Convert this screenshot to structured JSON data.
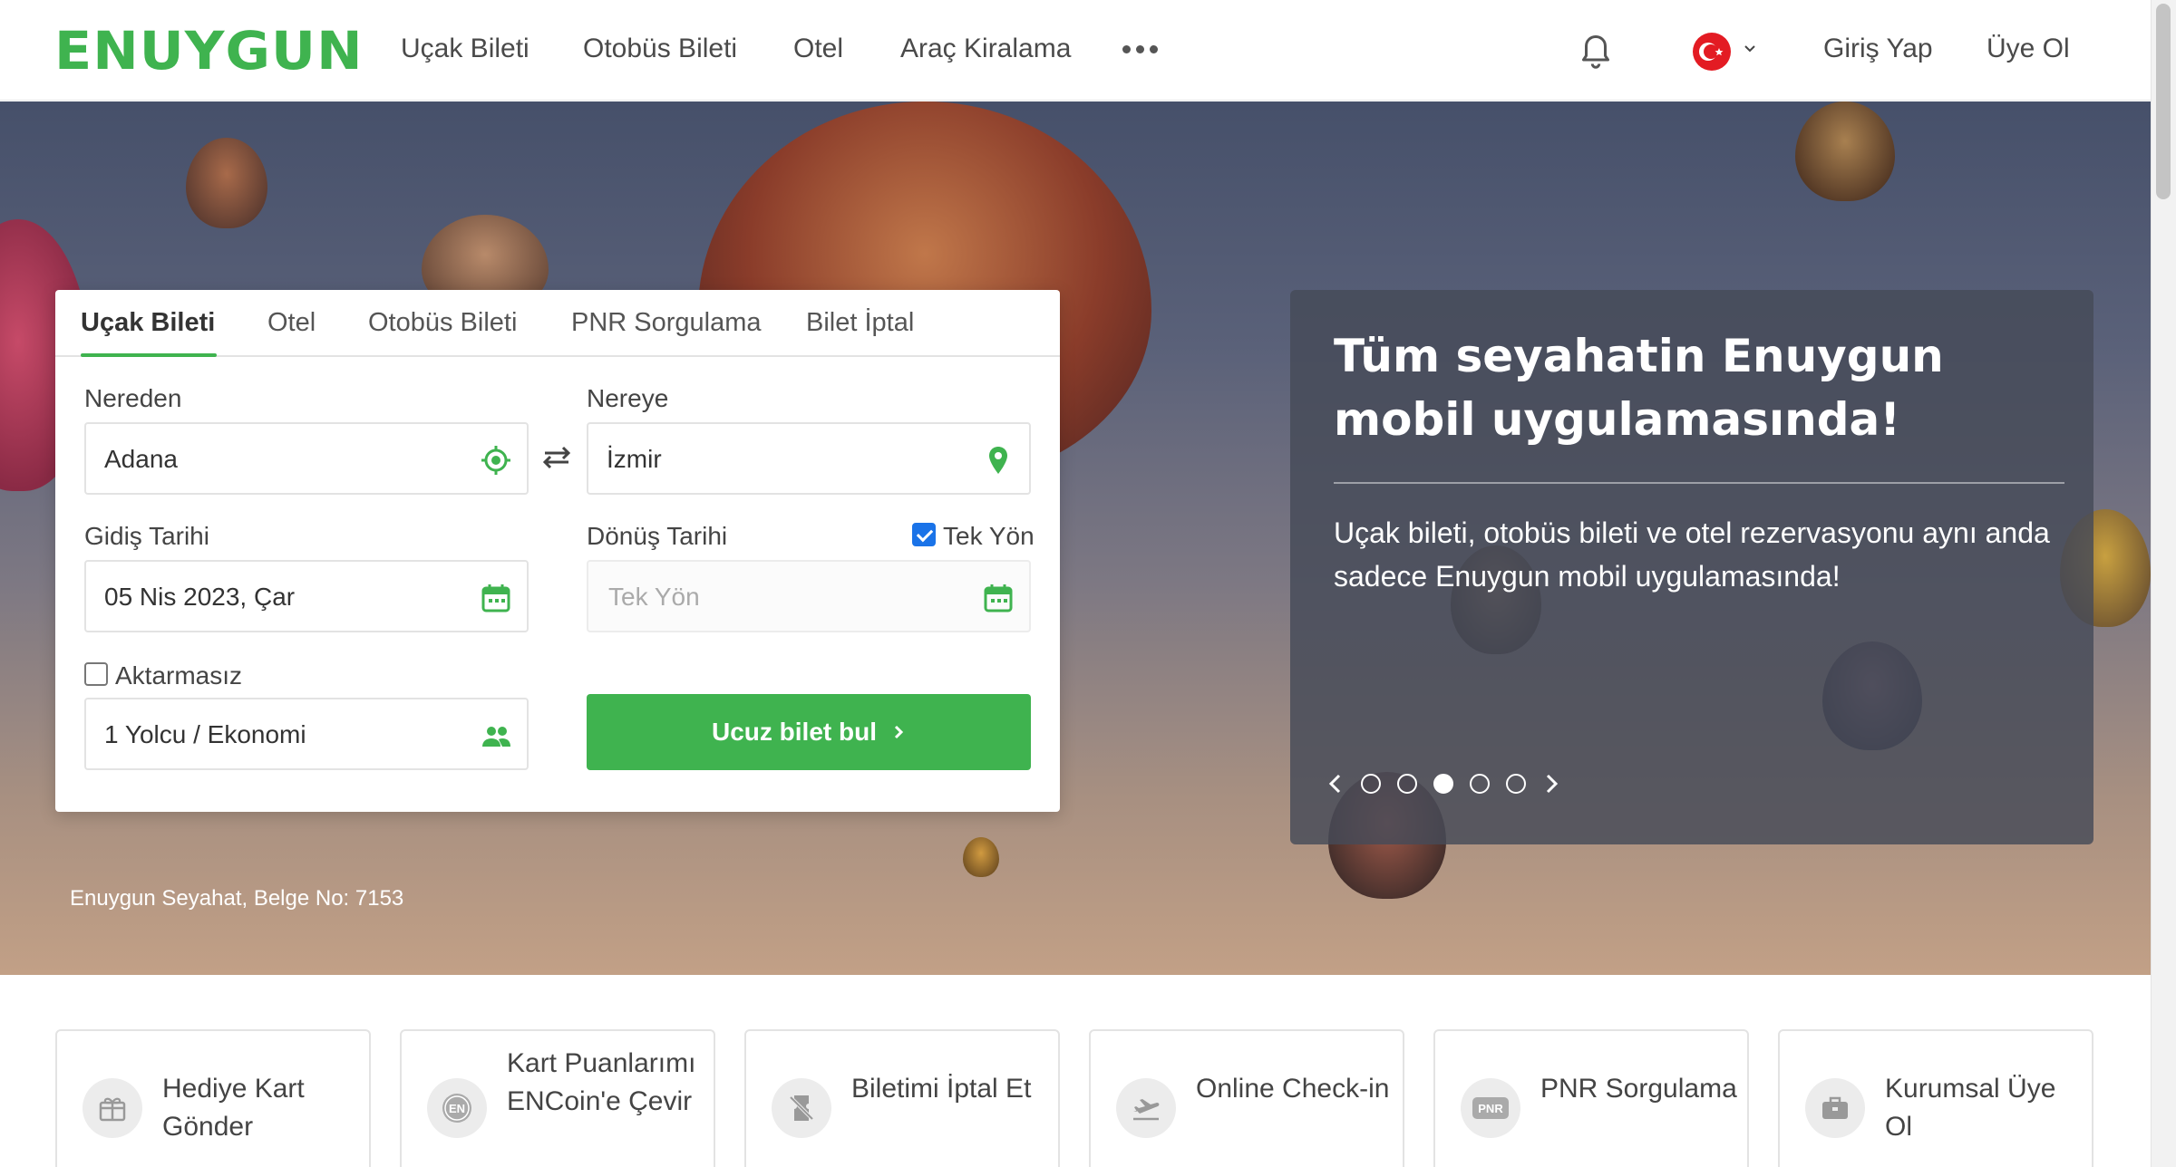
{
  "header": {
    "logo": "ENUYGUN",
    "nav": [
      "Uçak Bileti",
      "Otobüs Bileti",
      "Otel",
      "Araç Kiralama"
    ],
    "login": "Giriş Yap",
    "register": "Üye Ol",
    "icons": {
      "more": "more-dots-icon",
      "notifications": "bell-icon",
      "language": "turkey-flag-icon"
    }
  },
  "search": {
    "tabs": [
      "Uçak Bileti",
      "Otel",
      "Otobüs Bileti",
      "PNR Sorgulama",
      "Bilet İptal"
    ],
    "active_tab": "Uçak Bileti",
    "from_label": "Nereden",
    "from_value": "Adana",
    "to_label": "Nereye",
    "to_value": "İzmir",
    "depart_label": "Gidiş Tarihi",
    "depart_value": "05 Nis 2023, Çar",
    "return_label": "Dönüş Tarihi",
    "return_placeholder": "Tek Yön",
    "oneway_label": "Tek Yön",
    "oneway_checked": true,
    "direct_label": "Aktarmasız",
    "direct_checked": false,
    "passengers_value": "1 Yolcu / Ekonomi",
    "submit_label": "Ucuz bilet bul"
  },
  "hero": {
    "license_text": "Enuygun Seyahat, Belge No: 7153"
  },
  "promo": {
    "title": "Tüm seyahatin Enuygun mobil uygulamasında!",
    "text": "Uçak bileti, otobüs bileti ve otel rezervasyonu aynı anda sadece Enuygun mobil uygulamasında!",
    "slide_count": 5,
    "active_slide": 3
  },
  "quick_links": [
    {
      "label": "Hediye Kart Gönder",
      "icon": "gift-card-icon"
    },
    {
      "label": "Kart Puanlarımı ENCoin'e Çevir",
      "icon": "encoin-icon"
    },
    {
      "label": "Biletimi İptal Et",
      "icon": "ticket-cancel-icon"
    },
    {
      "label": "Online Check-in",
      "icon": "plane-departure-icon"
    },
    {
      "label": "PNR Sorgulama",
      "icon": "pnr-icon"
    },
    {
      "label": "Kurumsal Üye Ol",
      "icon": "briefcase-icon"
    }
  ],
  "colors": {
    "brand": "#3fb34f",
    "promo_overlay": "#464a58"
  }
}
